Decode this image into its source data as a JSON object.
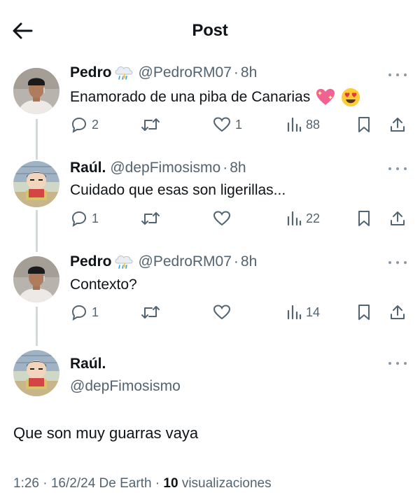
{
  "header": {
    "title": "Post",
    "back_icon": "arrow-left-icon"
  },
  "posts": [
    {
      "name": "Pedro",
      "handle": "@PedroRM07",
      "dot": "·",
      "time": "8h",
      "text": "Enamorado de una piba de Canarias",
      "emojis": [
        "sparkling-heart-emoji",
        "heart-eyes-emoji"
      ],
      "replies": "2",
      "reposts": "",
      "likes": "1",
      "views": "88"
    },
    {
      "name": "Raúl.",
      "handle": "@depFimosismo",
      "dot": "·",
      "time": "8h",
      "text": "Cuidado que esas son ligerillas...",
      "replies": "1",
      "reposts": "",
      "likes": "",
      "views": "22"
    },
    {
      "name": "Pedro",
      "handle": "@PedroRM07",
      "dot": "·",
      "time": "8h",
      "text": "Contexto?",
      "replies": "1",
      "reposts": "",
      "likes": "",
      "views": "14"
    }
  ],
  "focus": {
    "name": "Raúl.",
    "handle": "@depFimosismo",
    "text": "Que son muy guarras vaya",
    "time": "1:26 · 16/2/24 De Earth · ",
    "views_count": "10",
    "views_label": " visualizaciones"
  },
  "colors": {
    "text": "#0f1419",
    "muted": "#536471",
    "line": "#cfd9de"
  }
}
